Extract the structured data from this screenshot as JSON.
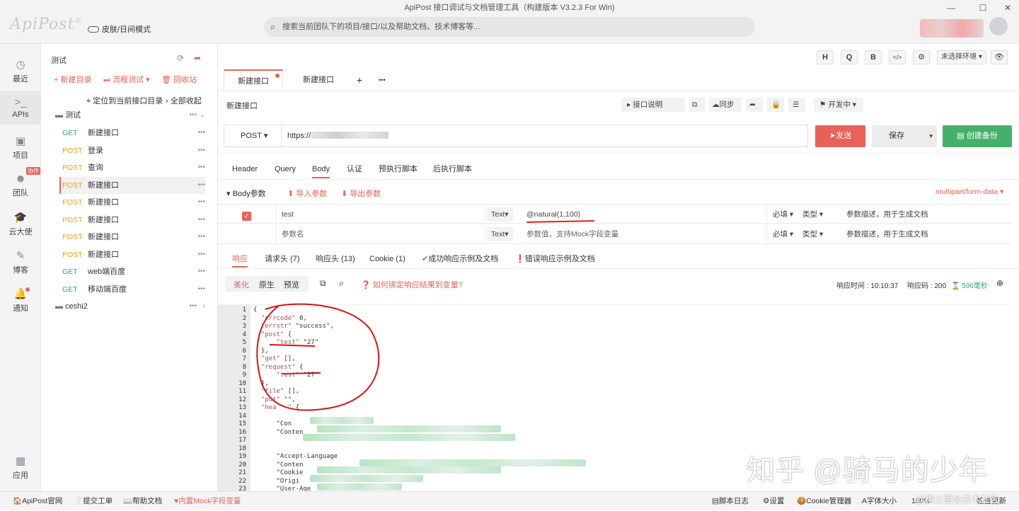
{
  "window": {
    "title": "ApiPost 接口调试与文档管理工具（构建版本 V3.2.3 For Win)",
    "min": "—",
    "max": "☐",
    "close": "✕"
  },
  "header": {
    "logo": "ApiPost",
    "logo_mark": "®",
    "skin_toggle": "皮肤/日间模式",
    "search_placeholder": "搜索当前团队下的项目/接口/以及帮助文档、技术博客等..."
  },
  "leftnav": [
    {
      "label": "最近",
      "icon": "clock-icon",
      "glyph": "◷"
    },
    {
      "label": "APIs",
      "icon": "terminal-icon",
      "glyph": ">_"
    },
    {
      "label": "项目",
      "icon": "project-icon",
      "glyph": "▣"
    },
    {
      "label": "团队",
      "icon": "team-icon",
      "glyph": "☻",
      "badge": "协作"
    },
    {
      "label": "云大使",
      "icon": "cap-icon",
      "glyph": "🎓"
    },
    {
      "label": "博客",
      "icon": "edit-icon",
      "glyph": "✎"
    },
    {
      "label": "通知",
      "icon": "bell-icon",
      "glyph": "🔔"
    },
    {
      "label": "应用",
      "icon": "apps-icon",
      "glyph": "▦"
    }
  ],
  "tree": {
    "title": "测试",
    "actions": {
      "new_dir": "+ 新建目录",
      "flow_test": "流程测试",
      "recycle": "回收站"
    },
    "locate": "定位到当前接口目录",
    "collapse_all": "全部收起",
    "folder1": "测试",
    "items": [
      {
        "method": "GET",
        "name": "新建接口"
      },
      {
        "method": "POST",
        "name": "登录"
      },
      {
        "method": "POST",
        "name": "查询"
      },
      {
        "method": "POST",
        "name": "新建接口"
      },
      {
        "method": "POST",
        "name": "新建接口"
      },
      {
        "method": "POST",
        "name": "新建接口"
      },
      {
        "method": "POST",
        "name": "新建接口"
      },
      {
        "method": "POST",
        "name": "新建接口"
      },
      {
        "method": "GET",
        "name": "web端百度"
      },
      {
        "method": "GET",
        "name": "移动端百度"
      }
    ],
    "folder2": "ceshi2"
  },
  "toolbar": {
    "h": "H",
    "q": "Q",
    "b": "B",
    "code": "</>",
    "settings": "⚙",
    "env": "未选择环境",
    "eye": "👁"
  },
  "tabs": [
    {
      "label": "新建接口"
    },
    {
      "label": "新建接口"
    }
  ],
  "tab_add": "+",
  "tab_more": "•••",
  "api": {
    "name": "新建接口",
    "desc_btn": "接口说明",
    "sync_btn": "同步",
    "status": "开发中",
    "method": "POST",
    "url": "https://",
    "send": "发送",
    "save": "保存",
    "backup": "创建备份"
  },
  "subtabs": [
    "Header",
    "Query",
    "Body",
    "认证",
    "预执行脚本",
    "后执行脚本"
  ],
  "body": {
    "label": "Body参数",
    "import": "导入参数",
    "export": "导出参数",
    "content_type": "multipart/form-data",
    "rows": [
      {
        "key": "test",
        "type": "Text",
        "value": "@natural(1,100)",
        "required": "必填",
        "dtype": "类型",
        "desc": "参数描述，用于生成文档",
        "checked": true
      },
      {
        "key": "参数名",
        "type": "Text",
        "value": "参数值，支持Mock字段变量",
        "required": "必填",
        "dtype": "类型",
        "desc": "参数描述，用于生成文档",
        "checked": false
      }
    ]
  },
  "response": {
    "tabs": [
      "响应",
      "请求头 (7)",
      "响应头 (13)",
      "Cookie (1)",
      "成功响应示例及文档",
      "错误响应示例及文档"
    ],
    "views": [
      "美化",
      "原生",
      "预览"
    ],
    "bind_help": "如何绑定响应结果到变量?",
    "time_label": "响应时间 : 10:10:37",
    "code_label": "响应码 : 200",
    "size_label": "596毫秒"
  },
  "code_lines": [
    {
      "n": "1",
      "t": "{"
    },
    {
      "n": "2",
      "t": "  \"errcode\": 0,"
    },
    {
      "n": "3",
      "t": "  \"errstr\": \"success\","
    },
    {
      "n": "4",
      "t": "  \"post\": {"
    },
    {
      "n": "5",
      "t": "      \"test\": \"27\""
    },
    {
      "n": "6",
      "t": "  },"
    },
    {
      "n": "7",
      "t": "  \"get\": [],"
    },
    {
      "n": "8",
      "t": "  \"request\": {"
    },
    {
      "n": "9",
      "t": "      \"test\": \"27\""
    },
    {
      "n": "10",
      "t": "  },"
    },
    {
      "n": "11",
      "t": "  \"file\": [],"
    },
    {
      "n": "12",
      "t": "  \"put\": \"\","
    },
    {
      "n": "13",
      "t": "  \"hea   \": {"
    },
    {
      "n": "14",
      "t": ""
    },
    {
      "n": "15",
      "t": "      \"Con"
    },
    {
      "n": "16",
      "t": "      \"Conten"
    },
    {
      "n": "17",
      "t": ""
    },
    {
      "n": "18",
      "t": ""
    },
    {
      "n": "19",
      "t": "      \"Accept-Language"
    },
    {
      "n": "20",
      "t": "      \"Conten"
    },
    {
      "n": "21",
      "t": "      \"Cookie"
    },
    {
      "n": "22",
      "t": "      \"Origi"
    },
    {
      "n": "23",
      "t": "      \"User-Age"
    }
  ],
  "status_bar": {
    "site": "ApiPost官网",
    "ticket": "提交工单",
    "help": "帮助文档",
    "mock": "内置Mock字段变量",
    "script_log": "脚本日志",
    "settings": "设置",
    "cookie_mgr": "Cookie管理器",
    "font_size": "字体大小",
    "zoom": "100%",
    "check_update": "检查更新"
  },
  "watermark": {
    "text": "知乎 @骑马的少年",
    "text2": "@稀土掘金技术社区"
  }
}
